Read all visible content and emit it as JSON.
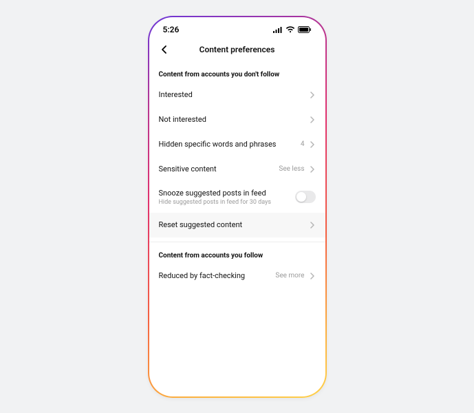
{
  "status": {
    "time": "5:26"
  },
  "nav": {
    "title": "Content preferences"
  },
  "section1": {
    "header": "Content from accounts you don't follow",
    "interested": "Interested",
    "not_interested": "Not interested",
    "hidden_words": "Hidden specific words and phrases",
    "hidden_words_count": "4",
    "sensitive": "Sensitive content",
    "sensitive_value": "See less",
    "snooze": "Snooze suggested posts in feed",
    "snooze_sub": "Hide suggested posts in feed for 30 days",
    "reset": "Reset suggested content"
  },
  "section2": {
    "header": "Content from accounts you follow",
    "fact_check": "Reduced by fact-checking",
    "fact_check_value": "See more"
  }
}
